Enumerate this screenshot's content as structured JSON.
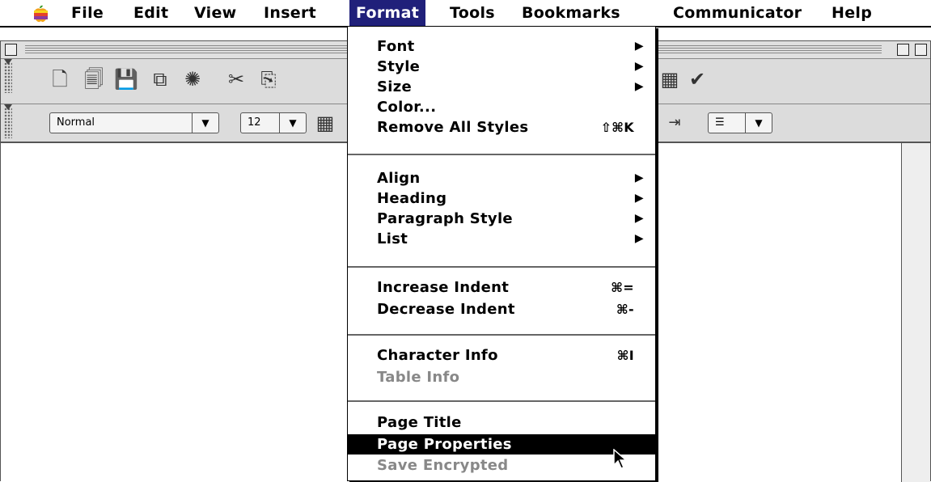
{
  "menubar": {
    "items": [
      "File",
      "Edit",
      "View",
      "Insert",
      "Format",
      "Tools",
      "Bookmarks",
      "Communicator",
      "Help"
    ],
    "active": "Format"
  },
  "toolbar": {
    "paragraph_style": "Normal",
    "font_size": "12"
  },
  "format_menu": {
    "items": [
      {
        "label": "Font",
        "submenu": true
      },
      {
        "label": "Style",
        "submenu": true
      },
      {
        "label": "Size",
        "submenu": true
      },
      {
        "label": "Color..."
      },
      {
        "label": "Remove All Styles",
        "shortcut": "⇧⌘K"
      },
      {
        "label": "Align",
        "submenu": true
      },
      {
        "label": "Heading",
        "submenu": true
      },
      {
        "label": "Paragraph Style",
        "submenu": true
      },
      {
        "label": "List",
        "submenu": true
      },
      {
        "label": "Increase Indent",
        "shortcut": "⌘="
      },
      {
        "label": "Decrease Indent",
        "shortcut": "⌘-"
      },
      {
        "label": "Character Info",
        "shortcut": "⌘I"
      },
      {
        "label": "Table Info",
        "disabled": true
      },
      {
        "label": "Page Title"
      },
      {
        "label": "Page Properties",
        "highlighted": true
      },
      {
        "label": "Save Encrypted",
        "disabled": true
      }
    ],
    "submenu_glyph": "▶"
  },
  "colors": {
    "menu_active": "#20207a",
    "highlight": "#000000"
  }
}
